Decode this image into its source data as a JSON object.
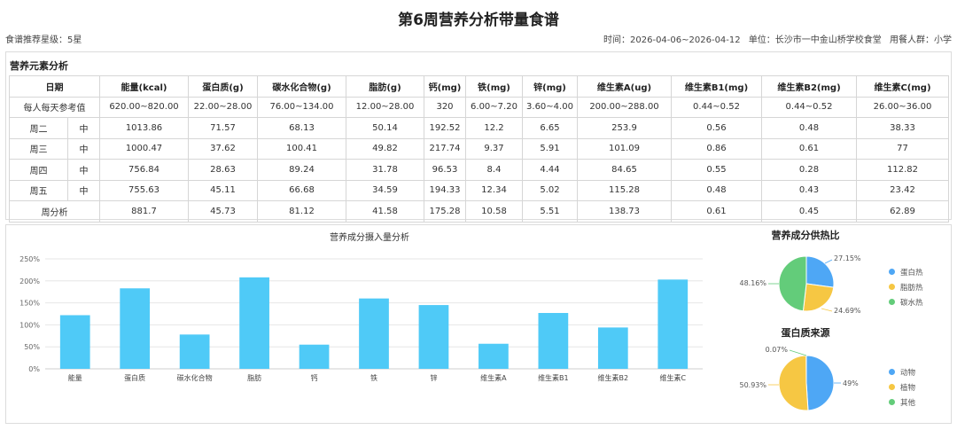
{
  "header": {
    "title": "第6周营养分析带量食谱",
    "rating": "食谱推荐星级：5星",
    "time": "时间：2026-04-06~2026-04-12",
    "unit": "单位：长沙市一中金山桥学校食堂",
    "group": "用餐人群：小学"
  },
  "table": {
    "section_title": "营养元素分析",
    "headers": [
      "日期",
      "能量(kcal)",
      "蛋白质(g)",
      "碳水化合物(g)",
      "脂肪(g)",
      "钙(mg)",
      "铁(mg)",
      "锌(mg)",
      "维生素A(ug)",
      "维生素B1(mg)",
      "维生素B2(mg)",
      "维生素C(mg)"
    ],
    "reference": {
      "label": "每人每天参考值",
      "values": [
        "620.00~820.00",
        "22.00~28.00",
        "76.00~134.00",
        "12.00~28.00",
        "320",
        "6.00~7.20",
        "3.60~4.00",
        "200.00~288.00",
        "0.44~0.52",
        "0.44~0.52",
        "26.00~36.00"
      ]
    },
    "rows": [
      {
        "day": "周二",
        "meal": "中",
        "values": [
          "1013.86",
          "71.57",
          "68.13",
          "50.14",
          "192.52",
          "12.2",
          "6.65",
          "253.9",
          "0.56",
          "0.48",
          "38.33"
        ]
      },
      {
        "day": "周三",
        "meal": "中",
        "values": [
          "1000.47",
          "37.62",
          "100.41",
          "49.82",
          "217.74",
          "9.37",
          "5.91",
          "101.09",
          "0.86",
          "0.61",
          "77"
        ]
      },
      {
        "day": "周四",
        "meal": "中",
        "values": [
          "756.84",
          "28.63",
          "89.24",
          "31.78",
          "96.53",
          "8.4",
          "4.44",
          "84.65",
          "0.55",
          "0.28",
          "112.82"
        ]
      },
      {
        "day": "周五",
        "meal": "中",
        "values": [
          "755.63",
          "45.11",
          "66.68",
          "34.59",
          "194.33",
          "12.34",
          "5.02",
          "115.28",
          "0.48",
          "0.43",
          "23.42"
        ]
      }
    ],
    "summary": {
      "label": "周分析",
      "values": [
        "881.7",
        "45.73",
        "81.12",
        "41.58",
        "175.28",
        "10.58",
        "5.51",
        "138.73",
        "0.61",
        "0.45",
        "62.89"
      ]
    }
  },
  "chart_data": [
    {
      "type": "bar",
      "title": "营养成分摄入量分析",
      "categories": [
        "能量",
        "蛋白质",
        "碳水化合物",
        "脂肪",
        "钙",
        "铁",
        "锌",
        "维生素A",
        "维生素B1",
        "维生素B2",
        "维生素C"
      ],
      "values": [
        122,
        183,
        78,
        208,
        55,
        160,
        145,
        57,
        127,
        94,
        203
      ],
      "ylim": [
        0,
        250
      ],
      "yticks": [
        0,
        50,
        100,
        150,
        200,
        250
      ],
      "ytick_suffix": "%",
      "grid": true,
      "color": "#4fcaf7"
    },
    {
      "type": "pie",
      "title": "营养成分供热比",
      "labels": [
        "蛋白热",
        "脂肪热",
        "碳水热"
      ],
      "values": [
        27.15,
        24.69,
        48.16
      ],
      "value_labels": [
        "27.15%",
        "24.69%",
        "48.16%"
      ],
      "colors": [
        "#4ea7f5",
        "#f6c743",
        "#63cc7a"
      ],
      "legend": "right"
    },
    {
      "type": "pie",
      "title": "蛋白质来源",
      "labels": [
        "动物",
        "植物",
        "其他"
      ],
      "values": [
        49,
        50.93,
        0.07
      ],
      "value_labels": [
        "49%",
        "50.93%",
        "0.07%"
      ],
      "colors": [
        "#4ea7f5",
        "#f6c743",
        "#63cc7a"
      ],
      "legend": "right"
    }
  ]
}
